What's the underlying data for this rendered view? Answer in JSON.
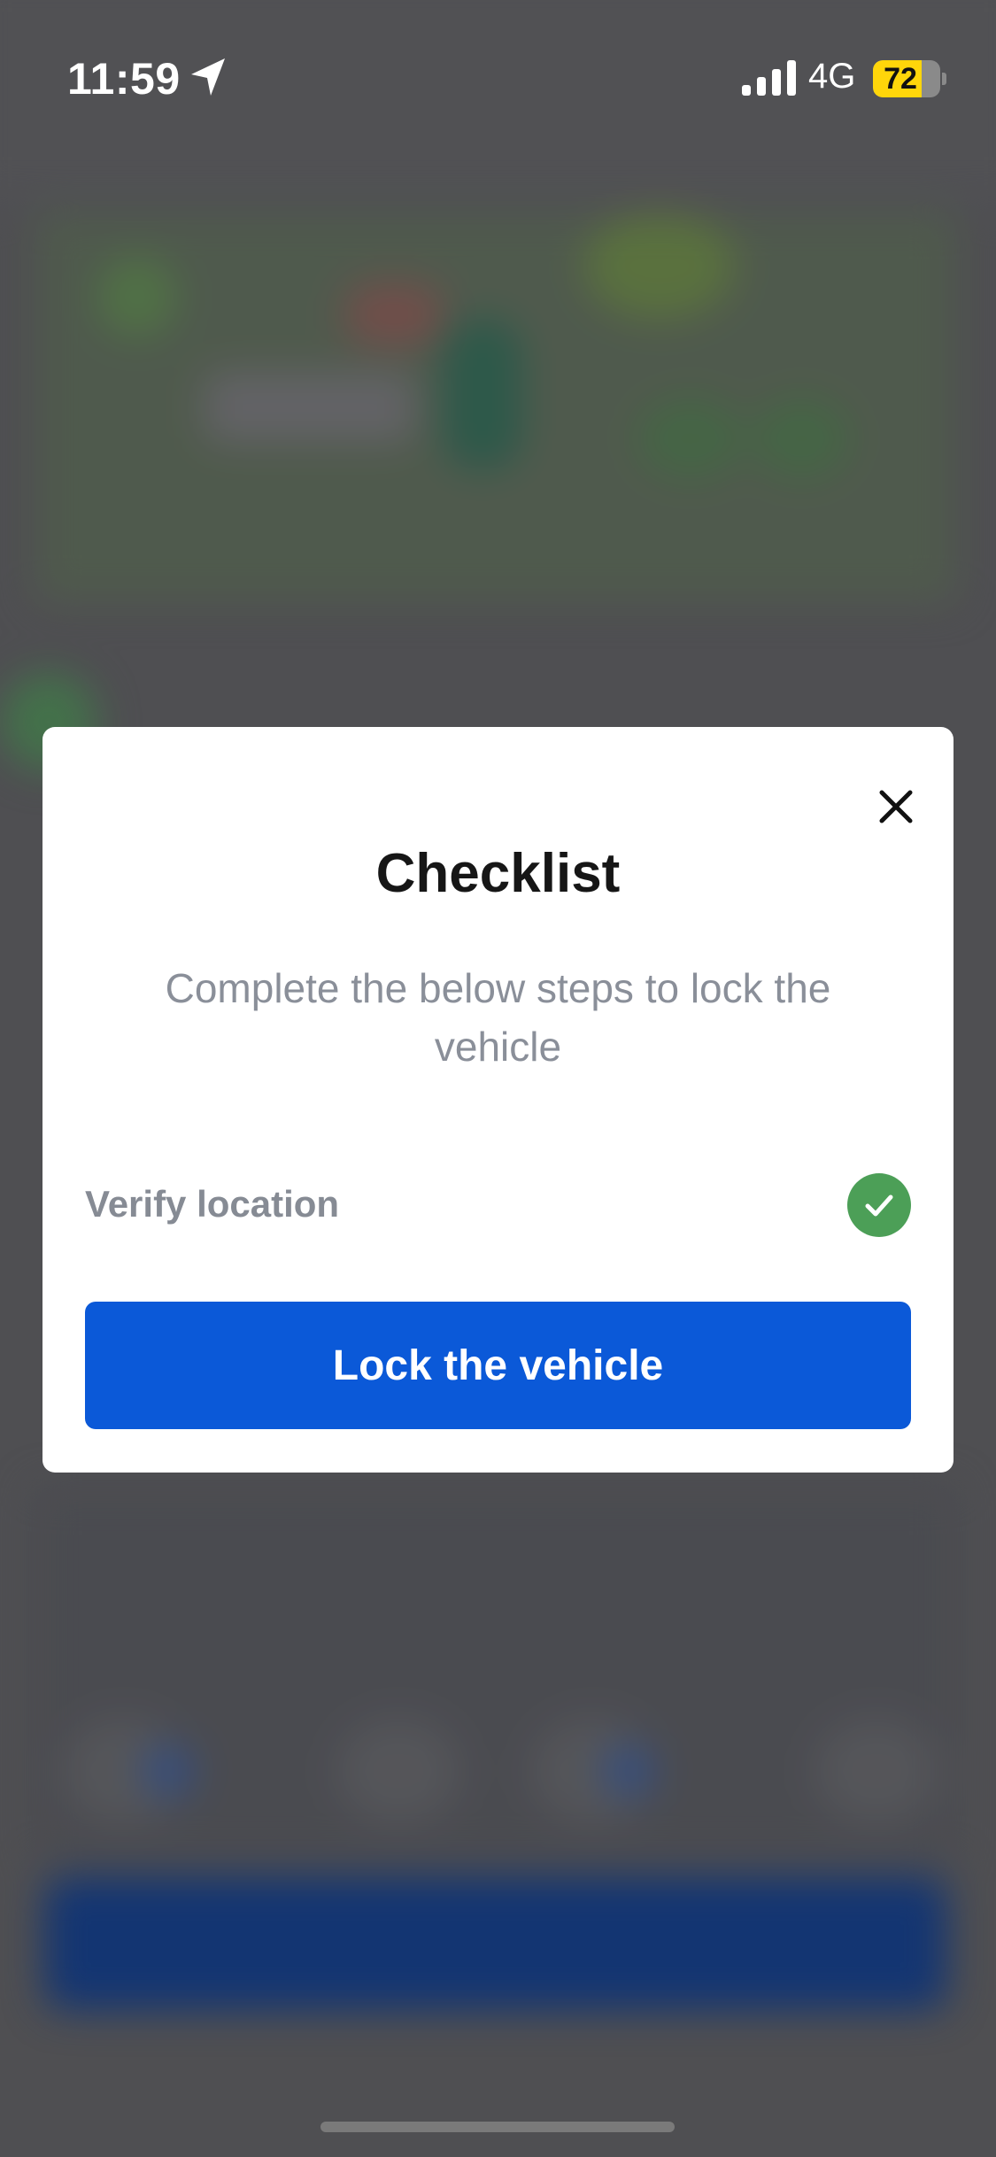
{
  "status_bar": {
    "time": "11:59",
    "network": "4G",
    "battery": "72",
    "battery_level": 0.72,
    "battery_color": "#ffd60a"
  },
  "modal": {
    "title": "Checklist",
    "subtitle": "Complete the below steps to lock the vehicle",
    "items": [
      {
        "label": "Verify location",
        "status": "completed",
        "icon": "check-circle-icon",
        "color": "#4c9f57"
      }
    ],
    "primary_button": {
      "label": "Lock the vehicle",
      "color": "#0b59d8"
    },
    "close_icon": "close-icon"
  }
}
